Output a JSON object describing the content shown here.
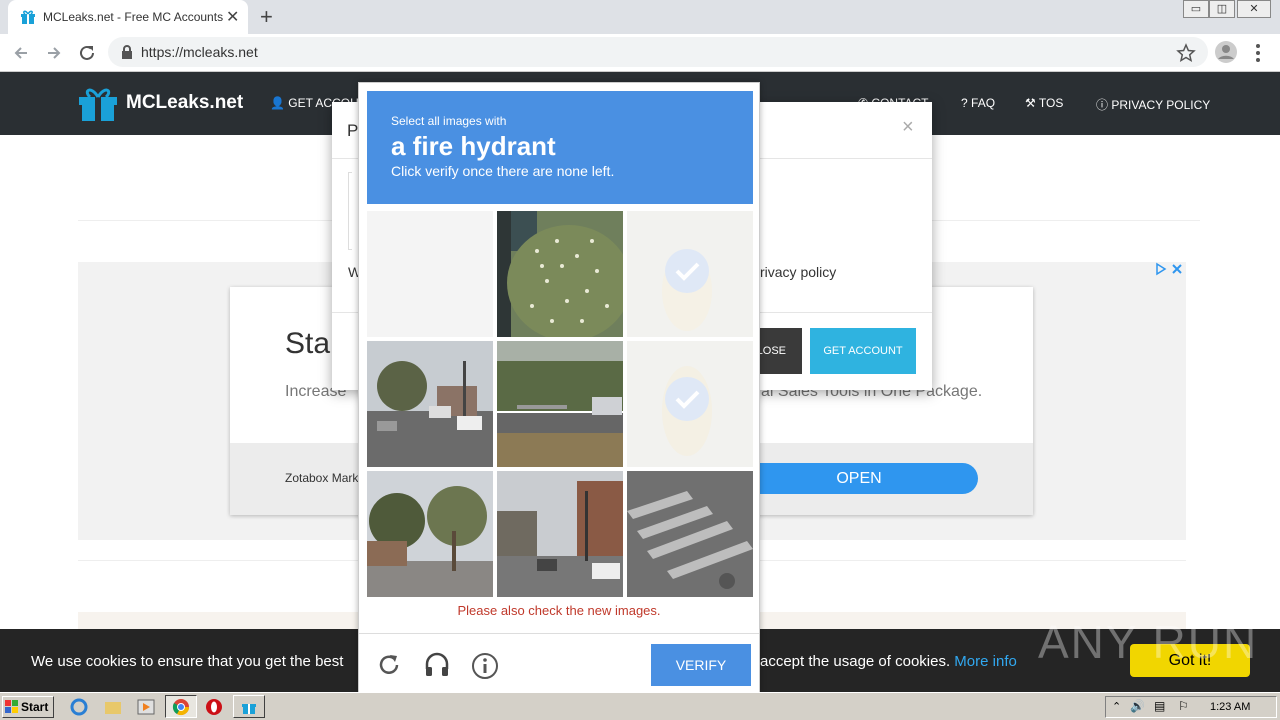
{
  "browser": {
    "tab_title": "MCLeaks.net - Free MC Accounts",
    "tab_close": "✕",
    "new_tab": "+",
    "url": "https://mcleaks.net",
    "win_min": "▭",
    "win_max": "◫",
    "win_close": "✕"
  },
  "site": {
    "logo": "MCLeaks.net",
    "nav": {
      "get_account": "GET ACCOUNT",
      "contact": "CONTACT",
      "faq": "FAQ",
      "tos": "TOS",
      "privacy": "PRIVACY POLICY"
    }
  },
  "modal": {
    "title_initial": "P",
    "close": "×",
    "body_initial": "W",
    "privacy_fragment": "rivacy policy",
    "close_button": "LOSE",
    "get_account_button": "GET ACCOUNT"
  },
  "ad": {
    "headline_fragment": "Sta",
    "sub_fragment": "Increase",
    "sub_fragment_right": "al Sales Tools in One Package.",
    "brand": "Zotabox Mark",
    "open_button": "OPEN"
  },
  "captcha": {
    "instruction_small": "Select all images with",
    "target": "a fire hydrant",
    "instruction_sub": "Click verify once there are none left.",
    "error_message": "Please also check the new images.",
    "verify_button": "VERIFY",
    "tiles": [
      {
        "name": "tile-1",
        "state": "loading"
      },
      {
        "name": "tile-2",
        "state": "image",
        "desc": "flowering bush"
      },
      {
        "name": "tile-3",
        "state": "selected"
      },
      {
        "name": "tile-4",
        "state": "image",
        "desc": "street intersection"
      },
      {
        "name": "tile-5",
        "state": "image",
        "desc": "road with truck"
      },
      {
        "name": "tile-6",
        "state": "selected"
      },
      {
        "name": "tile-7",
        "state": "image",
        "desc": "palm trees"
      },
      {
        "name": "tile-8",
        "state": "image",
        "desc": "city street"
      },
      {
        "name": "tile-9",
        "state": "image",
        "desc": "crosswalk"
      }
    ]
  },
  "cookie_bar": {
    "text": "We use cookies to ensure that you get the best",
    "text_right": "accept the usage of cookies.",
    "more_info": "More info",
    "button": "Got it!"
  },
  "watermark": "ANY RUN",
  "taskbar": {
    "start": "Start",
    "clock": "1:23 AM"
  }
}
